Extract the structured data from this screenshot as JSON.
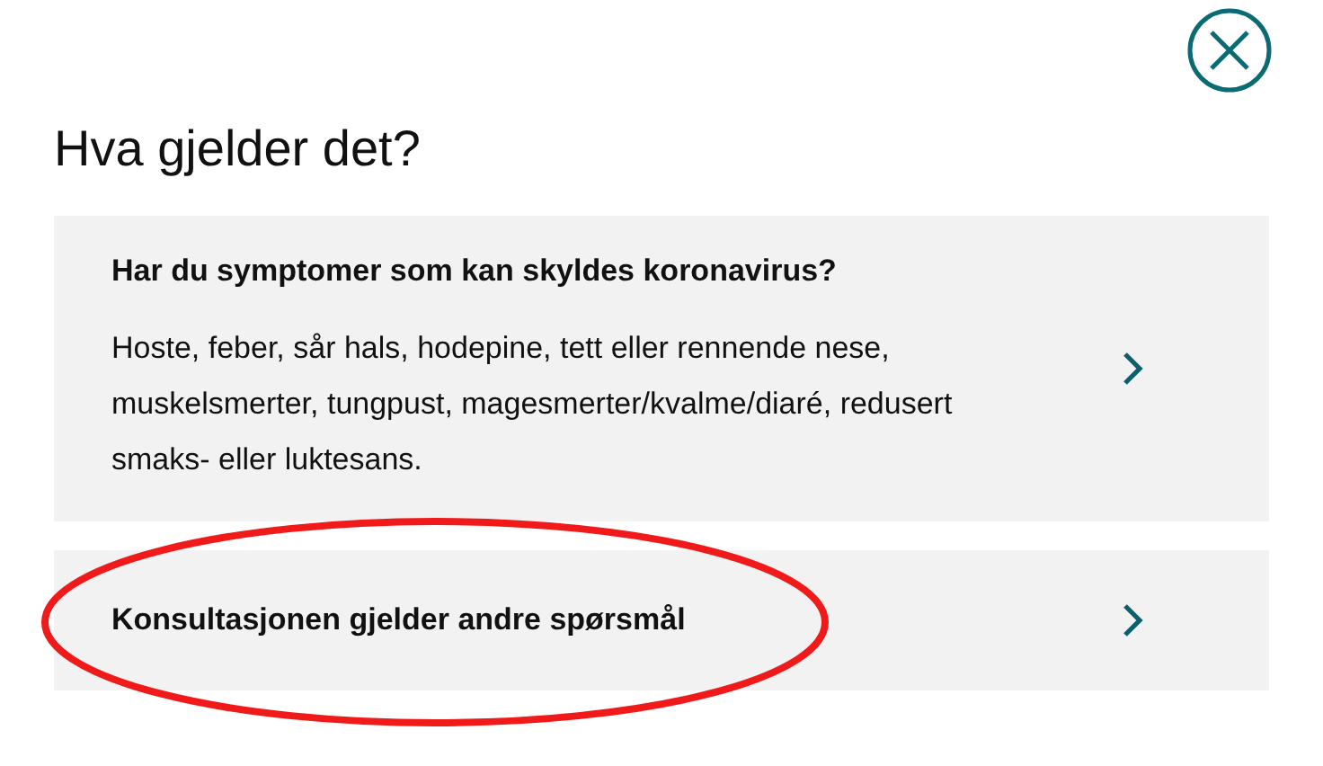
{
  "title": "Hva gjelder det?",
  "options": [
    {
      "heading": "Har du symptomer som kan skyldes koronavirus?",
      "description": "Hoste, feber, sår hals, hodepine, tett eller rennende nese, muskelsmerter, tungpust, magesmerter/kvalme/diaré, redusert smaks- eller luktesans.",
      "highlighted": false
    },
    {
      "heading": "Konsultasjonen gjelder andre spørsmål",
      "highlighted": true
    }
  ]
}
